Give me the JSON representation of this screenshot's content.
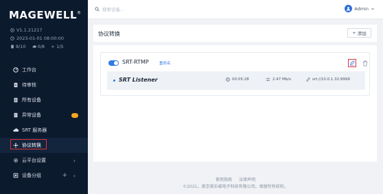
{
  "brand": {
    "logo": "MAGEWELL",
    "reg": "®"
  },
  "sidebar": {
    "version": "V1.1.21217",
    "datetime": "2023-01-01 08:00:00",
    "stats": {
      "devices": "8/10",
      "cloud": "0/8",
      "groups": "1/5"
    },
    "items": [
      {
        "label": "工作台"
      },
      {
        "label": "待审核"
      },
      {
        "label": "所有设备"
      },
      {
        "label": "异常设备"
      },
      {
        "label": "SRT 服务器"
      },
      {
        "label": "协议转换"
      },
      {
        "label": "云平台设置"
      },
      {
        "label": "设备分组"
      }
    ]
  },
  "topbar": {
    "search_placeholder": "搜索设备...",
    "user": "Admin"
  },
  "page": {
    "title": "协议转换",
    "add_label": "添加"
  },
  "card": {
    "title": "SRT-RTMP",
    "rename": "重命名",
    "stream": {
      "name": "SRT Listener",
      "duration": "00:05:28",
      "bitrate": "2.47 Mb/s",
      "url": "srt://10.0.1.32:9999"
    }
  },
  "footer": {
    "links": [
      "使用指南",
      "法律声明"
    ],
    "copyright": "©2021。南京美乐威电子科技有限公司。保留所有权利。"
  },
  "colors": {
    "accent": "#2f7be5",
    "sidebar_bg": "#0c1a2e",
    "highlight": "#e0333a",
    "badge": "#f5a623"
  }
}
